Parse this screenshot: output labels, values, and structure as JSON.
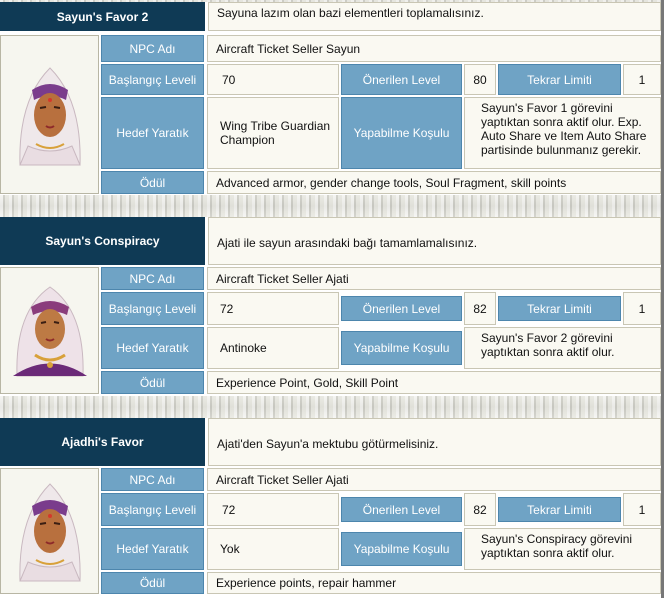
{
  "labels": {
    "npc": "NPC Adı",
    "start_level": "Başlangıç Leveli",
    "recommended_level": "Önerilen Level",
    "repeat_limit": "Tekrar Limiti",
    "target": "Hedef Yaratık",
    "requirement": "Yapabilme Koşulu",
    "reward": "Ödül"
  },
  "quests": [
    {
      "name": "Sayun's Favor 2",
      "description": "Sayuna lazım olan bazi elementleri toplamalısınız.",
      "npc": "Aircraft Ticket Seller Sayun",
      "start_level": "70",
      "recommended_level": "80",
      "repeat_limit": "1",
      "target": "Wing Tribe Guardian Champion",
      "requirement": "Sayun's Favor 1 görevini yaptıktan sonra aktif olur. Exp. Auto Share ve Item Auto Share partisinde bulunmanız gerekir.",
      "reward": "Advanced armor, gender change tools, Soul Fragment, skill points",
      "portrait_icon": "npc-portrait-icon"
    },
    {
      "name": "Sayun's Conspiracy",
      "description": "Ajati ile sayun arasındaki bağı tamamlamalısınız.",
      "npc": "Aircraft Ticket Seller Ajati",
      "start_level": "72",
      "recommended_level": "82",
      "repeat_limit": "1",
      "target": "Antinoke",
      "requirement": "Sayun's Favor 2 görevini yaptıktan sonra aktif olur.",
      "reward": "Experience Point, Gold, Skill Point",
      "portrait_icon": "npc-portrait-icon"
    },
    {
      "name": "Ajadhi's Favor",
      "description": "Ajati'den Sayun'a mektubu götürmelisiniz.",
      "npc": "Aircraft Ticket Seller Ajati",
      "start_level": "72",
      "recommended_level": "82",
      "repeat_limit": "1",
      "target": "Yok",
      "requirement": "Sayun's Conspiracy görevini yaptıktan sonra aktif olur.",
      "reward": "Experience points, repair hammer",
      "portrait_icon": "npc-portrait-icon"
    }
  ],
  "colors": {
    "title_bg": "#0f3a55",
    "label_bg": "#6fa3c5",
    "cell_bg": "#faf9f2"
  }
}
